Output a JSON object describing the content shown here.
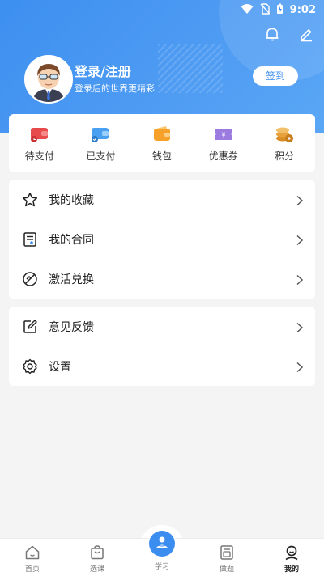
{
  "status_bar": {
    "time": "9:02"
  },
  "profile": {
    "login_title": "登录/注册",
    "login_subtitle": "登录后的世界更精彩",
    "sign_in_label": "签到"
  },
  "quick_actions": [
    {
      "label": "待支付",
      "icon": "wallet-pending-icon",
      "color": "#e74b4b"
    },
    {
      "label": "已支付",
      "icon": "wallet-paid-icon",
      "color": "#4aa0f0"
    },
    {
      "label": "钱包",
      "icon": "wallet-icon",
      "color": "#f7a12a"
    },
    {
      "label": "优惠券",
      "icon": "coupon-icon",
      "color": "#9b7be0"
    },
    {
      "label": "积分",
      "icon": "coins-icon",
      "color": "#e9a23b"
    }
  ],
  "menu_group_1": [
    {
      "label": "我的收藏",
      "icon": "star-icon"
    },
    {
      "label": "我的合同",
      "icon": "contract-icon"
    },
    {
      "label": "激活兑换",
      "icon": "activate-icon"
    }
  ],
  "menu_group_2": [
    {
      "label": "意见反馈",
      "icon": "feedback-edit-icon"
    },
    {
      "label": "设置",
      "icon": "settings-gear-icon"
    }
  ],
  "tabs": [
    {
      "label": "首页",
      "icon": "home-icon"
    },
    {
      "label": "选课",
      "icon": "bag-icon"
    },
    {
      "label": "学习",
      "icon": "study-icon"
    },
    {
      "label": "做题",
      "icon": "exercise-icon"
    },
    {
      "label": "我的",
      "icon": "user-icon",
      "active": true
    }
  ],
  "colors": {
    "accent": "#3b8df0"
  }
}
